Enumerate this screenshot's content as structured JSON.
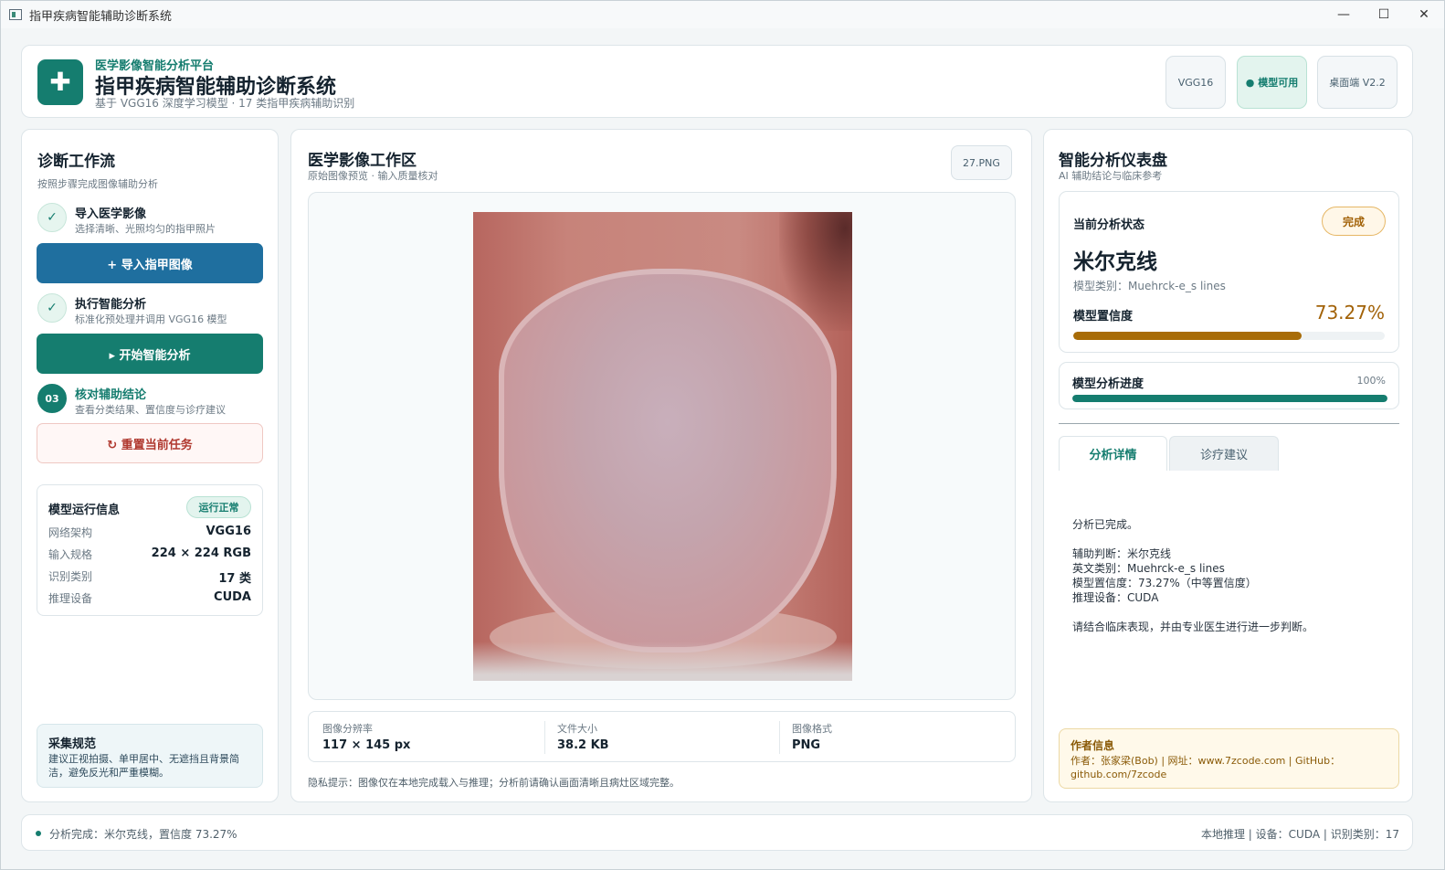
{
  "window": {
    "title": "指甲疾病智能辅助诊断系统",
    "controls": {
      "minimize": "—",
      "maximize": "☐",
      "close": "✕"
    }
  },
  "header": {
    "kicker": "医学影像智能分析平台",
    "title": "指甲疾病智能辅助诊断系统",
    "subtitle": "基于 VGG16 深度学习模型 · 17 类指甲疾病辅助识别",
    "chips": {
      "model_name": "VGG16",
      "model_status": "● 模型可用",
      "version": "桌面端 V2.2"
    }
  },
  "workflow": {
    "title": "诊断工作流",
    "subtitle": "按照步骤完成图像辅助分析",
    "steps": [
      {
        "badge": "✓",
        "title": "导入医学影像",
        "desc": "选择清晰、光照均匀的指甲照片"
      },
      {
        "badge": "✓",
        "title": "执行智能分析",
        "desc": "标准化预处理并调用 VGG16 模型"
      },
      {
        "badge": "03",
        "title": "核对辅助结论",
        "desc": "查看分类结果、置信度与诊疗建议"
      }
    ],
    "buttons": {
      "import": "+  导入指甲图像",
      "run": "▸  开始智能分析",
      "reset": "↻  重置当前任务"
    },
    "model_info": {
      "title": "模型运行信息",
      "status": "运行正常",
      "rows": [
        {
          "k": "网络架构",
          "v": "VGG16"
        },
        {
          "k": "输入规格",
          "v": "224 × 224 RGB"
        },
        {
          "k": "识别类别",
          "v": "17 类"
        },
        {
          "k": "推理设备",
          "v": "CUDA"
        }
      ]
    },
    "norm": {
      "title": "采集规范",
      "text": "建议正视拍摄、单甲居中、无遮挡且背景简洁，避免反光和严重模糊。"
    }
  },
  "workspace": {
    "title": "医学影像工作区",
    "subtitle": "原始图像预览 · 输入质量核对",
    "file_name": "27.PNG",
    "meta": [
      {
        "k": "图像分辨率",
        "v": "117 × 145 px"
      },
      {
        "k": "文件大小",
        "v": "38.2 KB"
      },
      {
        "k": "图像格式",
        "v": "PNG"
      }
    ],
    "privacy": "隐私提示：图像仅在本地完成载入与推理；分析前请确认画面清晰且病灶区域完整。"
  },
  "dashboard": {
    "title": "智能分析仪表盘",
    "subtitle": "AI 辅助结论与临床参考",
    "status_label": "当前分析状态",
    "status": "完成",
    "result": "米尔克线",
    "category": "模型类别：Muehrck-e_s lines",
    "confidence_label": "模型置信度",
    "confidence": "73.27%",
    "confidence_value": 0.7327,
    "progress_label": "模型分析进度",
    "progress": "100%",
    "progress_value": 1.0,
    "tabs": [
      "分析详情",
      "诊疗建议"
    ],
    "detail": "分析已完成。\n\n辅助判断：米尔克线\n英文类别：Muehrck-e_s lines\n模型置信度：73.27%（中等置信度）\n推理设备：CUDA\n\n请结合临床表现，并由专业医生进行进一步判断。",
    "author_title": "作者信息",
    "author_text": "作者：张家梁(Bob)  |  网址：www.7zcode.com  |  GitHub：github.com/7zcode"
  },
  "footer": {
    "left": "分析完成：米尔克线，置信度 73.27%",
    "right": "本地推理  |  设备：CUDA  |  识别类别：17"
  },
  "colors": {
    "primary": "#157d6f",
    "import_button": "#1f6f9f",
    "confidence_bar": "#a86c08",
    "progress_bar": "#157d6f",
    "reset_text": "#b0392f"
  }
}
